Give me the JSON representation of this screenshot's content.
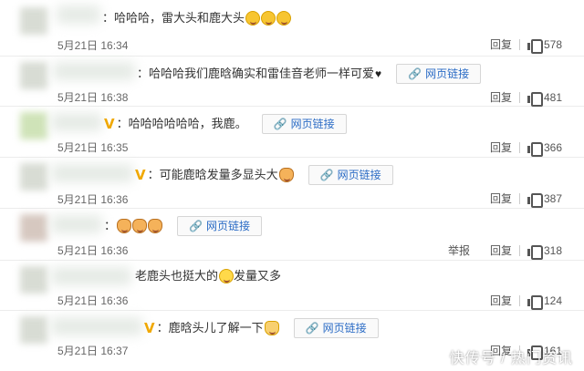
{
  "comments": [
    {
      "text": "：哈哈哈，雷大头和鹿大头",
      "emojis": [
        "grinning-sweat-emoji",
        "grinning-sweat-emoji",
        "grinning-sweat-emoji"
      ],
      "time": "5月21日 16:34",
      "reply": "回复",
      "likes": "578"
    },
    {
      "text": "：哈哈哈我们鹿晗确实和雷佳音老师一样可爱",
      "heart": "♥",
      "link": "网页链接",
      "time": "5月21日 16:38",
      "reply": "回复",
      "likes": "481"
    },
    {
      "verified": "V",
      "text": "：哈哈哈哈哈哈，我鹿。",
      "link": "网页链接",
      "time": "5月21日 16:35",
      "reply": "回复",
      "likes": "366"
    },
    {
      "verified": "V",
      "text": "：可能鹿晗发量多显头大",
      "link": "网页链接",
      "time": "5月21日 16:36",
      "reply": "回复",
      "likes": "387"
    },
    {
      "text": "：",
      "link": "网页链接",
      "time": "5月21日 16:36",
      "report": "举报",
      "reply": "回复",
      "likes": "318"
    },
    {
      "text": "老鹿头也挺大的",
      "text_after": "发量又多",
      "time": "5月21日 16:36",
      "reply": "回复",
      "likes": "124"
    },
    {
      "verified": "V",
      "text": "：鹿晗头儿了解一下",
      "link": "网页链接",
      "time": "5月21日 16:37",
      "reply": "回复",
      "likes": "161"
    }
  ],
  "watermark": "快传号 / 热门资讯"
}
